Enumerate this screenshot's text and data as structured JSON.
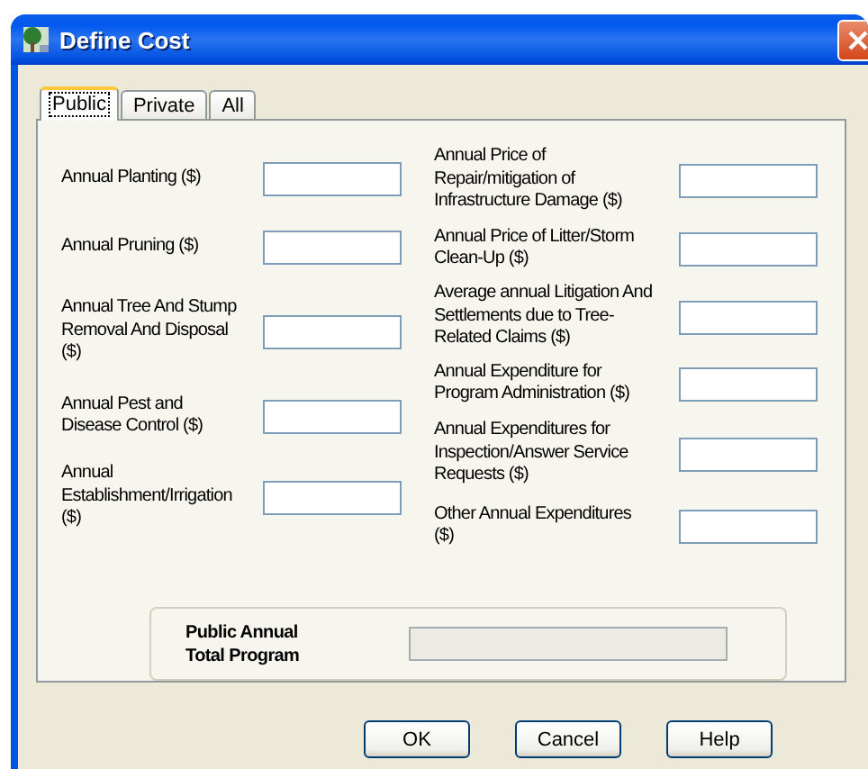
{
  "window": {
    "title": "Define Cost"
  },
  "tabs": [
    {
      "label": "Public",
      "selected": true
    },
    {
      "label": "Private",
      "selected": false
    },
    {
      "label": "All",
      "selected": false
    }
  ],
  "left_fields": [
    {
      "label": "Annual Planting ($)"
    },
    {
      "label": "Annual Pruning ($)"
    },
    {
      "label": "Annual Tree And Stump Removal And Disposal ($)"
    },
    {
      "label": "Annual Pest and Disease Control ($)"
    },
    {
      "label": "Annual Establishment/Irrigation ($)"
    }
  ],
  "right_fields": [
    {
      "label": "Annual Price of Repair/mitigation of Infrastructure Damage ($)"
    },
    {
      "label": "Annual Price of Litter/Storm Clean-Up ($)"
    },
    {
      "label": "Average annual Litigation And Settlements due to Tree-Related Claims ($)"
    },
    {
      "label": "Annual Expenditure for Program Administration ($)"
    },
    {
      "label": "Annual Expenditures for Inspection/Answer Service Requests ($)"
    },
    {
      "label": "Other Annual Expenditures ($)"
    }
  ],
  "total": {
    "label": "Public Annual Total Program",
    "disabled": true
  },
  "buttons": [
    {
      "label": "OK"
    },
    {
      "label": "Cancel"
    },
    {
      "label": "Help"
    }
  ]
}
